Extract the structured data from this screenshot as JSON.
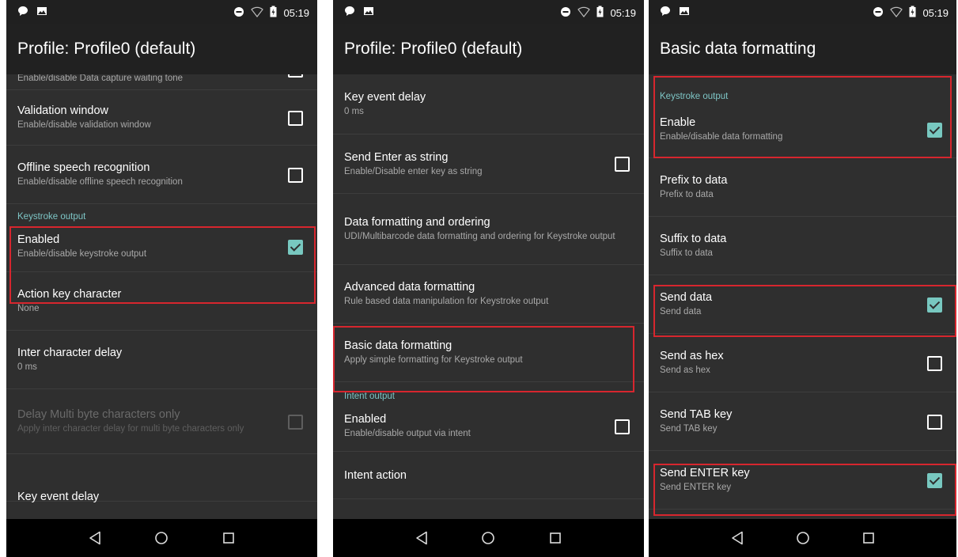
{
  "status": {
    "time": "05:19"
  },
  "screens": [
    {
      "title": "Profile: Profile0 (default)",
      "rows": [
        {
          "kind": "item",
          "title": "",
          "subtitle": "Enable/disable Data capture waiting tone",
          "checkbox": "checked"
        },
        {
          "kind": "item",
          "title": "Validation window",
          "subtitle": "Enable/disable validation window",
          "checkbox": "unchecked"
        },
        {
          "kind": "item",
          "title": "Offline speech recognition",
          "subtitle": "Enable/disable offline speech recognition",
          "checkbox": "unchecked"
        },
        {
          "kind": "category",
          "label": "Keystroke output"
        },
        {
          "kind": "item",
          "title": "Enabled",
          "subtitle": "Enable/disable keystroke output",
          "checkbox": "checked"
        },
        {
          "kind": "item",
          "title": "Action key character",
          "subtitle": "None"
        },
        {
          "kind": "item",
          "title": "Inter character delay",
          "subtitle": "0 ms"
        },
        {
          "kind": "item",
          "title": "Delay Multi byte characters only",
          "subtitle": "Apply inter character delay for multi byte characters only",
          "checkbox": "unchecked",
          "disabled": true
        },
        {
          "kind": "item",
          "title": "Key event delay",
          "subtitle": ""
        }
      ]
    },
    {
      "title": "Profile: Profile0 (default)",
      "rows": [
        {
          "kind": "item",
          "title": "Key event delay",
          "subtitle": "0 ms"
        },
        {
          "kind": "item",
          "title": "Send Enter as string",
          "subtitle": "Enable/Disable enter key as string",
          "checkbox": "unchecked"
        },
        {
          "kind": "item",
          "title": "Data formatting and ordering",
          "subtitle": "UDI/Multibarcode data formatting and ordering for Keystroke output"
        },
        {
          "kind": "item",
          "title": "Advanced data formatting",
          "subtitle": "Rule based data manipulation for Keystroke output"
        },
        {
          "kind": "item",
          "title": "Basic data formatting",
          "subtitle": "Apply simple formatting for Keystroke output"
        },
        {
          "kind": "category",
          "label": "Intent output"
        },
        {
          "kind": "item",
          "title": "Enabled",
          "subtitle": "Enable/disable output via intent",
          "checkbox": "unchecked"
        },
        {
          "kind": "item",
          "title": "Intent action",
          "subtitle": ""
        }
      ]
    },
    {
      "title": "Basic data formatting",
      "rows": [
        {
          "kind": "category",
          "label": "Keystroke output"
        },
        {
          "kind": "item",
          "title": "Enable",
          "subtitle": "Enable/disable data formatting",
          "checkbox": "checked"
        },
        {
          "kind": "item",
          "title": "Prefix to data",
          "subtitle": "Prefix to data"
        },
        {
          "kind": "item",
          "title": "Suffix to data",
          "subtitle": "Suffix to data"
        },
        {
          "kind": "item",
          "title": "Send data",
          "subtitle": "Send data",
          "checkbox": "checked"
        },
        {
          "kind": "item",
          "title": "Send as hex",
          "subtitle": "Send as hex",
          "checkbox": "unchecked"
        },
        {
          "kind": "item",
          "title": "Send TAB key",
          "subtitle": "Send TAB key",
          "checkbox": "unchecked"
        },
        {
          "kind": "item",
          "title": "Send ENTER key",
          "subtitle": "Send ENTER key",
          "checkbox": "checked"
        }
      ]
    }
  ],
  "colors": {
    "accent": "#78c8c0",
    "highlight": "#d7262e",
    "background": "#2f2f2f",
    "appbar": "#212121"
  },
  "icons": [
    "chat-bubble-icon",
    "image-icon",
    "do-not-disturb-icon",
    "wifi-icon",
    "battery-charging-icon",
    "back-icon",
    "home-icon",
    "recents-icon"
  ]
}
